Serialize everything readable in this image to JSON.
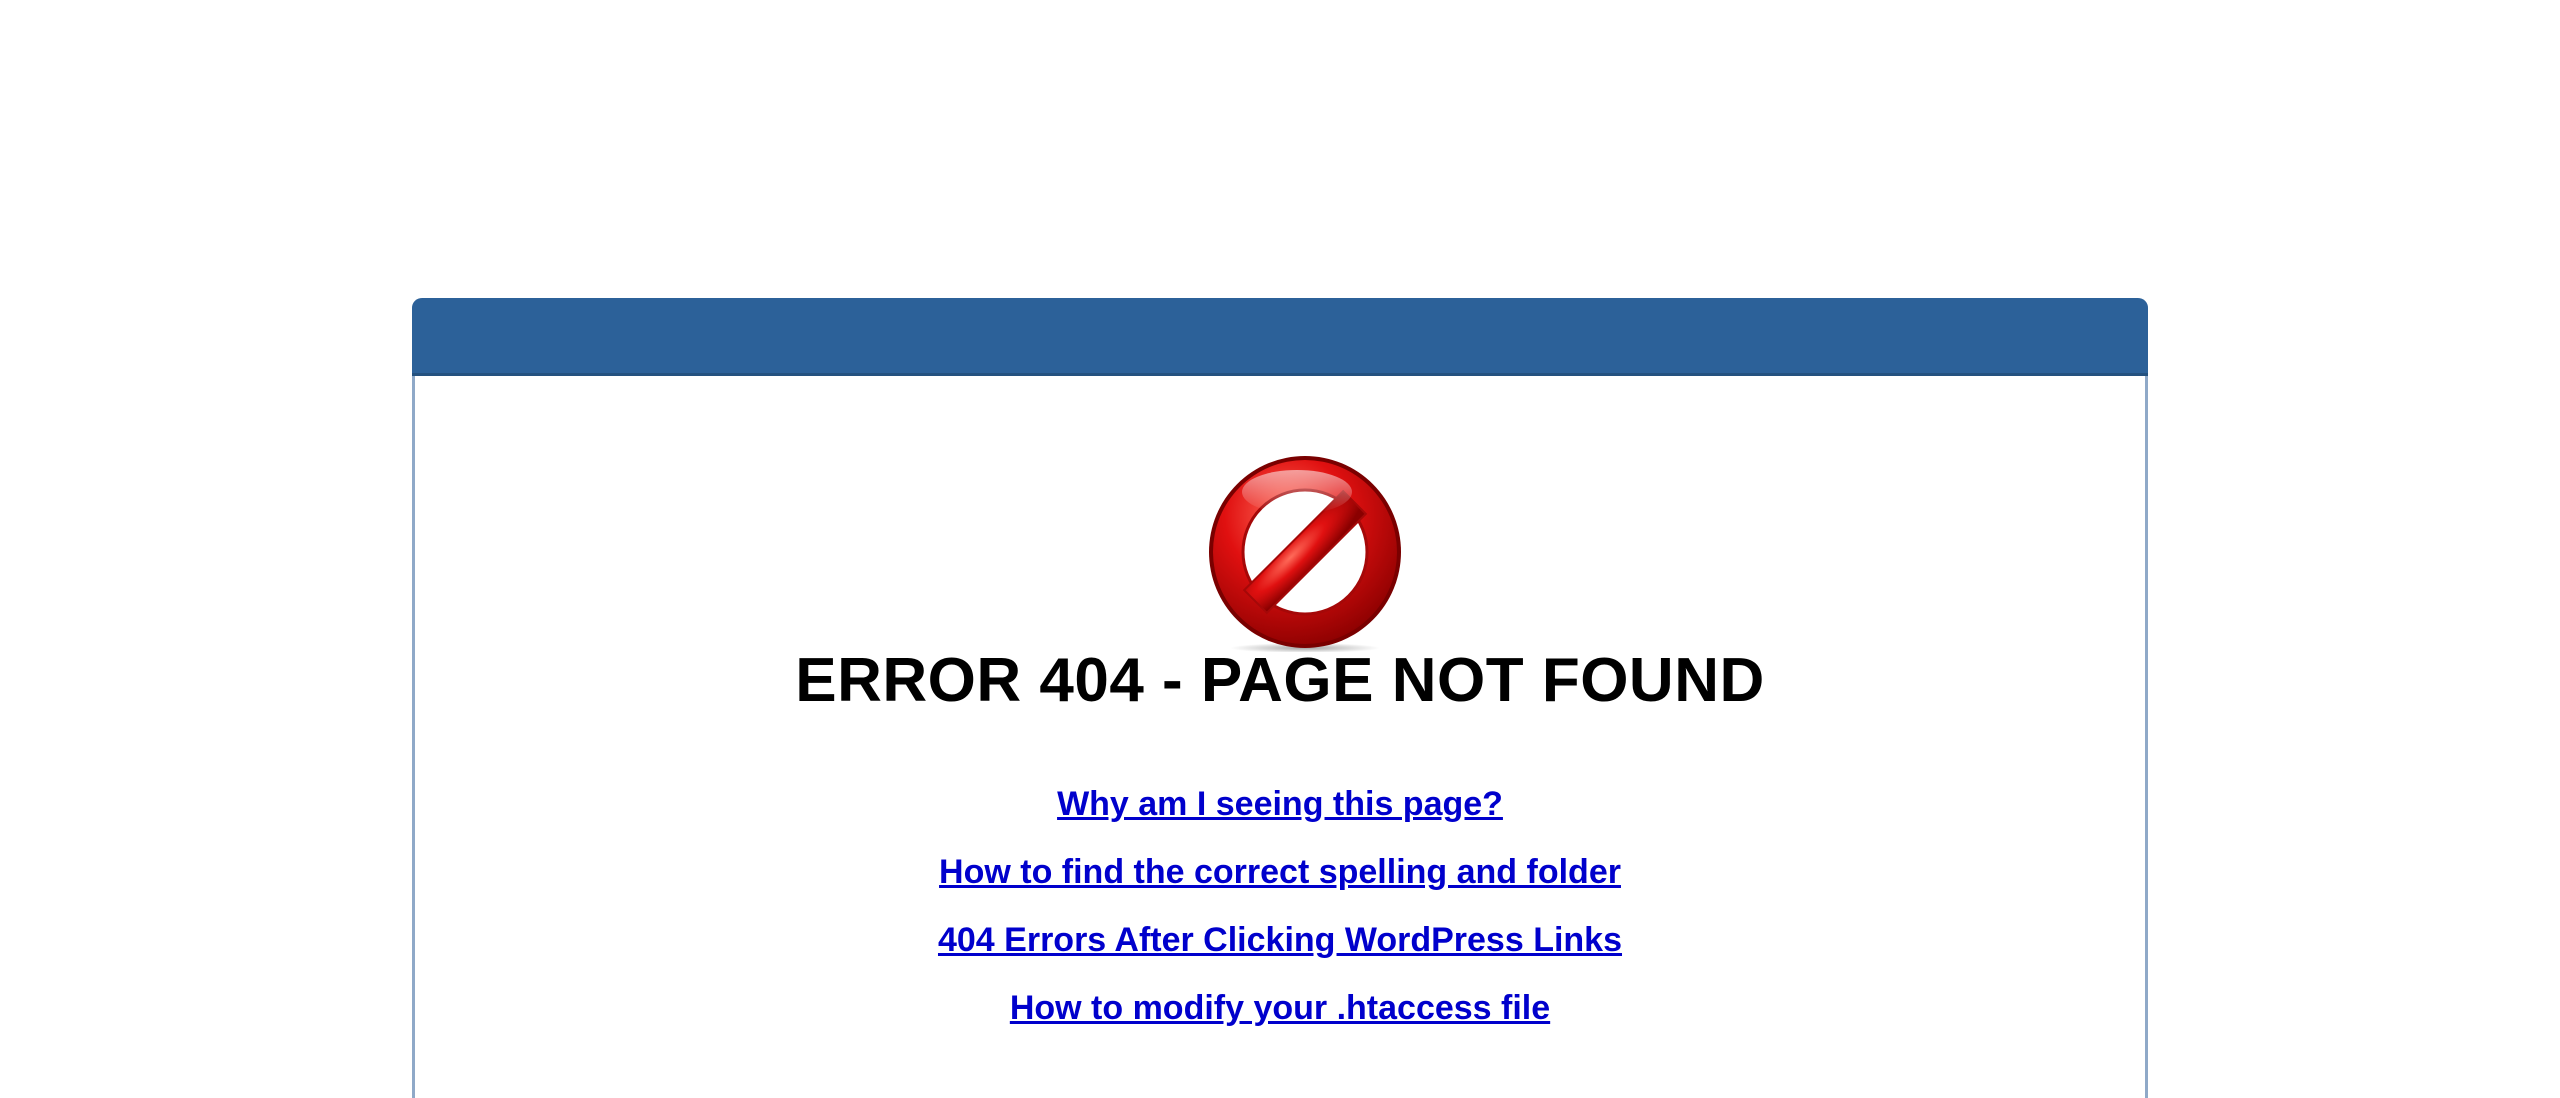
{
  "error": {
    "icon": "prohibited-sign-icon",
    "title": "ERROR 404 - PAGE NOT FOUND"
  },
  "links": [
    {
      "label": "Why am I seeing this page?"
    },
    {
      "label": "How to find the correct spelling and folder"
    },
    {
      "label": "404 Errors After Clicking WordPress Links"
    },
    {
      "label": "How to modify your .htaccess file"
    }
  ],
  "colors": {
    "header": "#2c6199",
    "panel_border": "#8fa9c8",
    "link": "#0000cc",
    "icon_red": "#d20f0f"
  }
}
